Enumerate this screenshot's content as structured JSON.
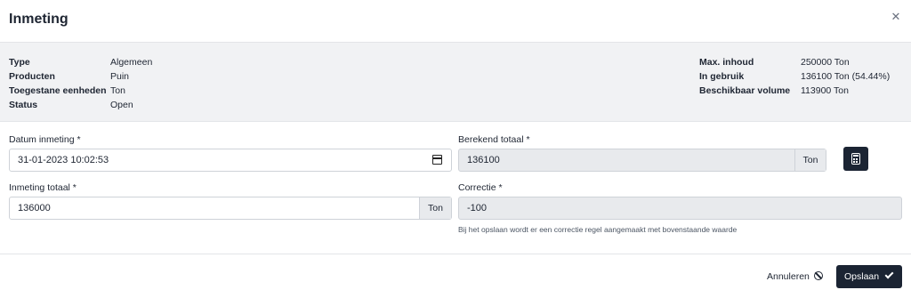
{
  "modal": {
    "title": "Inmeting"
  },
  "info": {
    "left": [
      {
        "key": "Type",
        "value": "Algemeen"
      },
      {
        "key": "Producten",
        "value": "Puin"
      },
      {
        "key": "Toegestane eenheden",
        "value": "Ton"
      },
      {
        "key": "Status",
        "value": "Open"
      }
    ],
    "right": [
      {
        "key": "Max. inhoud",
        "value": "250000 Ton"
      },
      {
        "key": "In gebruik",
        "value": "136100 Ton (54.44%)"
      },
      {
        "key": "Beschikbaar volume",
        "value": "113900 Ton"
      }
    ]
  },
  "form": {
    "datum": {
      "label": "Datum inmeting *",
      "value": "31-01-2023 10:02:53"
    },
    "berekend": {
      "label": "Berekend totaal *",
      "value": "136100",
      "unit": "Ton"
    },
    "inmeting": {
      "label": "Inmeting totaal *",
      "value": "136000",
      "unit": "Ton"
    },
    "correctie": {
      "label": "Correctie *",
      "value": "-100",
      "hint": "Bij het opslaan wordt er een correctie regel aangemaakt met bovenstaande waarde"
    }
  },
  "footer": {
    "cancel_label": "Annuleren",
    "save_label": "Opslaan"
  },
  "colors": {
    "primary": "#1b2433",
    "info_bg": "#f1f2f4",
    "disabled_bg": "#e8eaed"
  }
}
